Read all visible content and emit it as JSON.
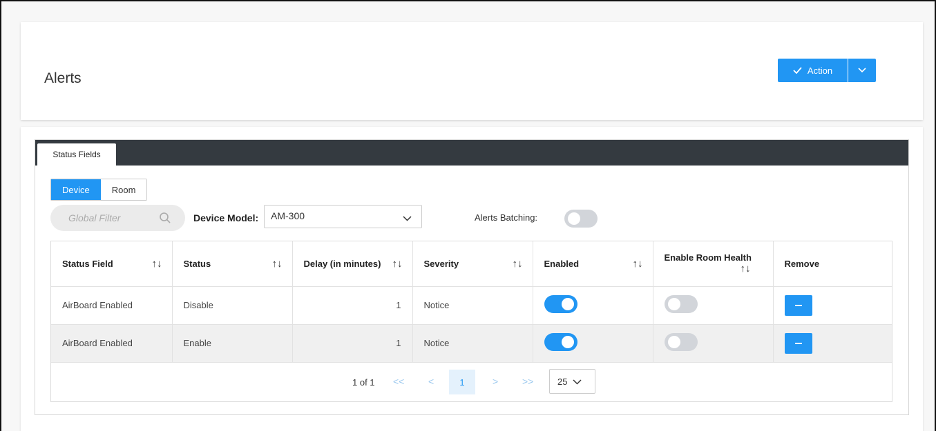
{
  "header": {
    "title": "Alerts",
    "action_label": "Action",
    "action_icon": "check-icon"
  },
  "tabs": [
    {
      "label": "Status Fields",
      "active": true
    }
  ],
  "scope_toggle": {
    "options": [
      "Device",
      "Room"
    ],
    "selected": "Device"
  },
  "filter": {
    "placeholder": "Global Filter"
  },
  "device_model": {
    "label": "Device Model:",
    "value": "AM-300"
  },
  "alerts_batching": {
    "label": "Alerts Batching:",
    "enabled": false
  },
  "table": {
    "columns": [
      {
        "label": "Status Field",
        "sortable": true
      },
      {
        "label": "Status",
        "sortable": true
      },
      {
        "label": "Delay (in minutes)",
        "sortable": true
      },
      {
        "label": "Severity",
        "sortable": true
      },
      {
        "label": "Enabled",
        "sortable": true
      },
      {
        "label": "Enable Room Health",
        "sortable": true
      },
      {
        "label": "Remove",
        "sortable": false
      }
    ],
    "sort_glyph": "↑↓",
    "rows": [
      {
        "status_field": "AirBoard Enabled",
        "status": "Disable",
        "delay": "1",
        "severity": "Notice",
        "enabled": true,
        "room_health": false
      },
      {
        "status_field": "AirBoard Enabled",
        "status": "Enable",
        "delay": "1",
        "severity": "Notice",
        "enabled": true,
        "room_health": false
      }
    ]
  },
  "pagination": {
    "info": "1 of 1",
    "first": "<<",
    "prev": "<",
    "current_page": "1",
    "next": ">",
    "last": ">>",
    "page_size": "25"
  },
  "colors": {
    "accent": "#2196f3",
    "tab_bar": "#343a40"
  }
}
